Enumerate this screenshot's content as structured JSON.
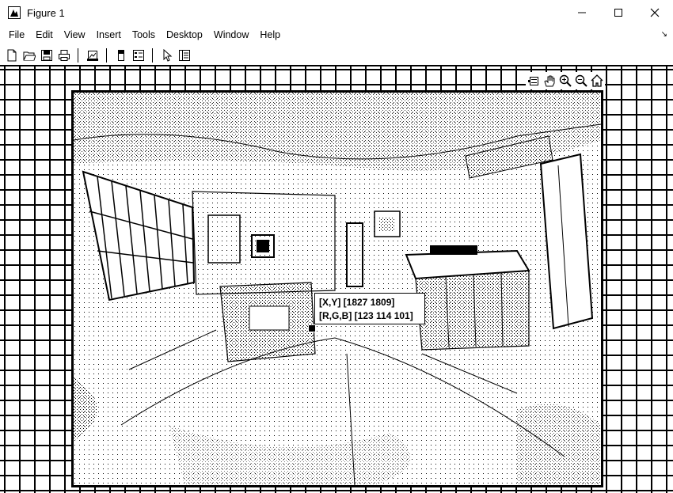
{
  "window": {
    "title": "Figure 1",
    "app_icon": "matlab-figure-icon",
    "controls": [
      "minimize-icon",
      "maximize-icon",
      "close-icon"
    ]
  },
  "menu": {
    "items": [
      "File",
      "Edit",
      "View",
      "Insert",
      "Tools",
      "Desktop",
      "Window",
      "Help"
    ],
    "overflow_icon": "dock-arrow-icon"
  },
  "toolbar": {
    "buttons": [
      "new-figure-icon",
      "open-file-icon",
      "save-icon",
      "print-icon",
      "link-plot-icon",
      "insert-colorbar-icon",
      "insert-legend-icon",
      "edit-plot-icon",
      "property-inspector-icon"
    ]
  },
  "axes_toolbar": {
    "buttons": [
      "data-tips-icon",
      "pan-icon",
      "zoom-in-icon",
      "zoom-out-icon",
      "restore-view-icon"
    ]
  },
  "datatip": {
    "line1": "[X,Y] [1827 1809]",
    "line2": "[R,G,B] [123 114 101]"
  },
  "image": {
    "subject": "dithered black-and-white photo of a kitchen interior"
  },
  "colors": {
    "foreground": "#000000",
    "background": "#ffffff"
  }
}
